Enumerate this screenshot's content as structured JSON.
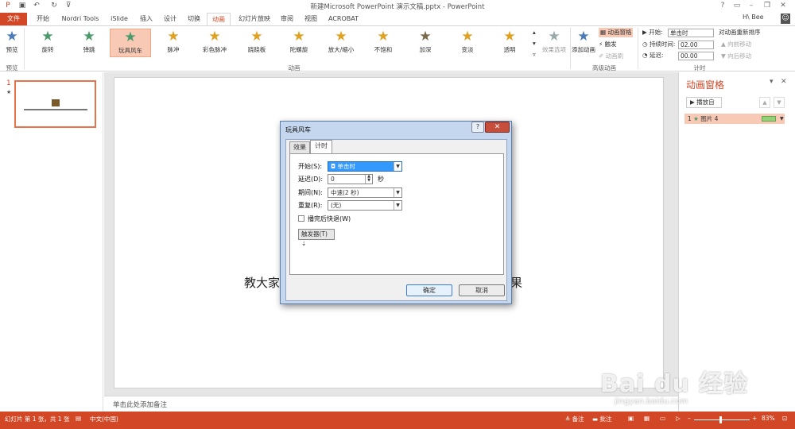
{
  "window": {
    "title": "新建Microsoft PowerPoint 演示文稿.pptx - PowerPoint",
    "user": "H\\ Bee",
    "help": "?"
  },
  "tabs": [
    "文件",
    "开始",
    "Nordri Tools",
    "iSlide",
    "插入",
    "设计",
    "切换",
    "动画",
    "幻灯片放映",
    "审阅",
    "视图",
    "ACROBAT"
  ],
  "ribbon": {
    "preview_label": "预览",
    "preview_group": "预览",
    "animations": [
      {
        "label": "旋转",
        "color": "#4a9a6a"
      },
      {
        "label": "弹跳",
        "color": "#4a9a6a"
      },
      {
        "label": "玩具风车",
        "color": "#4a9a6a"
      },
      {
        "label": "脉冲",
        "color": "#e0a020"
      },
      {
        "label": "彩色脉冲",
        "color": "#e0a020"
      },
      {
        "label": "跷跷板",
        "color": "#e0a020"
      },
      {
        "label": "陀螺旋",
        "color": "#e0a020"
      },
      {
        "label": "放大/缩小",
        "color": "#e0a020"
      },
      {
        "label": "不饱和",
        "color": "#e0a020"
      },
      {
        "label": "加深",
        "color": "#7a6a4a"
      },
      {
        "label": "变淡",
        "color": "#e0a020"
      },
      {
        "label": "透明",
        "color": "#e0a020"
      }
    ],
    "animation_group": "动画",
    "effect_options": "效果选项",
    "add_animation": "添加动画",
    "anim_pane_btn": "动画窗格",
    "trigger_btn": "触发",
    "anim_painter": "动画刷",
    "advanced_group": "高级动画",
    "start_label": "开始:",
    "start_value": "单击时",
    "duration_label": "持续时间:",
    "duration_value": "02.00",
    "delay_label": "延迟:",
    "delay_value": "00.00",
    "reorder_label": "对动画重新排序",
    "move_earlier": "向前移动",
    "move_later": "向后移动",
    "timing_group": "计时"
  },
  "thumbnails": {
    "slide_number": "1",
    "star": "★"
  },
  "slide": {
    "text_left": "教大家",
    "text_right": "果"
  },
  "notes": {
    "placeholder": "单击此处添加备注"
  },
  "anim_pane": {
    "title": "动画窗格",
    "play_from": "播放自",
    "item_number": "1",
    "item_name": "图片 4"
  },
  "dialog": {
    "title": "玩具风车",
    "tabs": [
      "效果",
      "计时"
    ],
    "start_label": "开始(S):",
    "start_value": "单击时",
    "delay_label": "延迟(D):",
    "delay_value": "0",
    "delay_unit": "秒",
    "period_label": "期间(N):",
    "period_value": "中速(2 秒)",
    "repeat_label": "重复(R):",
    "repeat_value": "(无)",
    "rewind_label": "播完后快退(W)",
    "trigger_label": "触发器(T)",
    "ok": "确定",
    "cancel": "取消"
  },
  "status": {
    "slide_info": "幻灯片 第 1 张，共 1 张",
    "language": "中文(中国)",
    "notes": "备注",
    "comments": "批注",
    "zoom": "83%"
  },
  "watermark": {
    "logo": "Bai du 经验",
    "url": "jingyan.baidu.com"
  },
  "colors": {
    "accent": "#d24726",
    "selected": "#f8c9b4"
  }
}
